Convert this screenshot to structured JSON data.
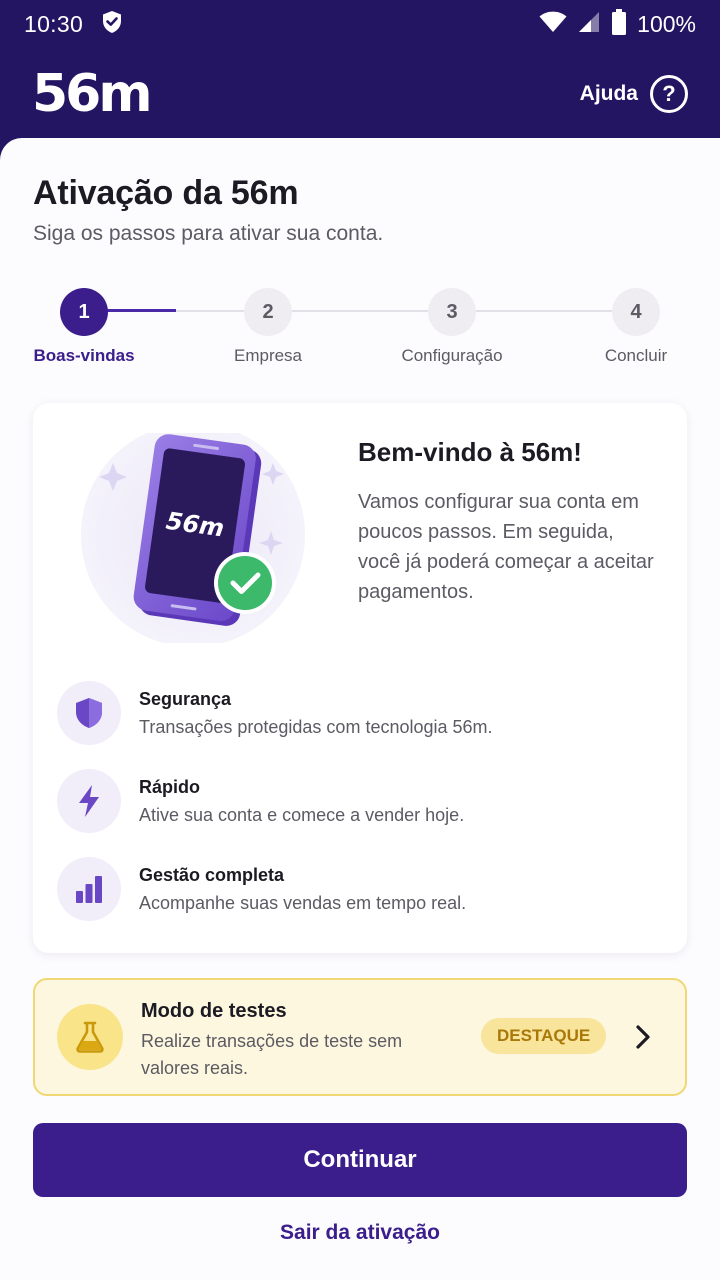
{
  "status_bar": {
    "time": "10:30",
    "battery": "100%",
    "icons": [
      "shield-check-icon",
      "wifi-icon",
      "signal-icon",
      "battery-icon"
    ]
  },
  "header": {
    "brand": "56m",
    "help_label": "Ajuda",
    "help_icon": "help-circle-icon"
  },
  "page": {
    "title": "Ativação da 56m",
    "subtitle": "Siga os passos para ativar sua conta."
  },
  "stepper": {
    "current_step": 1,
    "steps": [
      {
        "number": "1",
        "label": "Boas-vindas"
      },
      {
        "number": "2",
        "label": "Empresa"
      },
      {
        "number": "3",
        "label": "Configuração"
      },
      {
        "number": "4",
        "label": "Concluir"
      }
    ]
  },
  "welcome": {
    "phone_brand": "56m",
    "title": "Bem-vindo à 56m!",
    "text": "Vamos configurar sua conta em poucos passos. Em seguida, você já poderá começar a aceitar pagamentos.",
    "features": [
      {
        "icon": "shield-icon",
        "title": "Segurança",
        "description": "Transações protegidas com tecnologia 56m."
      },
      {
        "icon": "lightning-icon",
        "title": "Rápido",
        "description": "Ative sua conta e comece a vender hoje."
      },
      {
        "icon": "bar-chart-icon",
        "title": "Gestão completa",
        "description": "Acompanhe suas vendas em tempo real."
      }
    ]
  },
  "test_mode": {
    "icon": "flask-icon",
    "title": "Modo de testes",
    "description": "Realize transações de teste sem valores reais.",
    "badge": "DESTAQUE"
  },
  "actions": {
    "continue_label": "Continuar",
    "exit_label": "Sair da ativação"
  },
  "colors": {
    "primary": "#3b1e8c",
    "header_bg": "#241563",
    "success": "#3cb96b",
    "highlight_bg": "#fdf7df",
    "highlight_border": "#f1d774"
  }
}
